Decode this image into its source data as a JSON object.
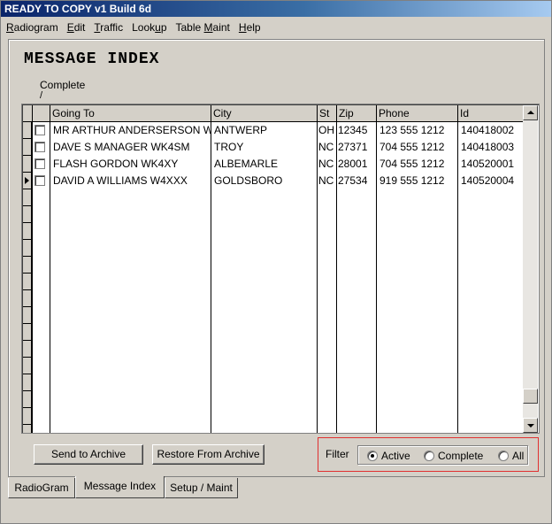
{
  "window": {
    "title": "READY TO COPY v1 Build 6d"
  },
  "menubar": {
    "items": [
      {
        "label_pre": "",
        "label_u": "R",
        "label_post": "adiogram"
      },
      {
        "label_pre": "",
        "label_u": "E",
        "label_post": "dit"
      },
      {
        "label_pre": "",
        "label_u": "T",
        "label_post": "raffic"
      },
      {
        "label_pre": "Look",
        "label_u": "u",
        "label_post": "p"
      },
      {
        "label_pre": "Table ",
        "label_u": "M",
        "label_post": "aint"
      },
      {
        "label_pre": "",
        "label_u": "H",
        "label_post": "elp"
      }
    ]
  },
  "page": {
    "title": "MESSAGE INDEX",
    "complete_column_label": "Complete",
    "complete_column_slash": "/"
  },
  "grid": {
    "headers": [
      "Going To",
      "City",
      "St",
      "Zip",
      "Phone",
      "Id"
    ],
    "rows": [
      {
        "complete": false,
        "going_to": "MR ARTHUR ANDERSERSON W",
        "city": "ANTWERP",
        "st": "OH",
        "zip": "12345",
        "phone": "123 555 1212",
        "id": "140418002",
        "current": false
      },
      {
        "complete": false,
        "going_to": "DAVE S MANAGER WK4SM",
        "city": "TROY",
        "st": "NC",
        "zip": "27371",
        "phone": "704 555 1212",
        "id": "140418003",
        "current": false
      },
      {
        "complete": false,
        "going_to": "FLASH GORDON WK4XY",
        "city": "ALBEMARLE",
        "st": "NC",
        "zip": "28001",
        "phone": "704 555 1212",
        "id": "140520001",
        "current": false
      },
      {
        "complete": false,
        "going_to": "DAVID A WILLIAMS W4XXX",
        "city": "GOLDSBORO",
        "st": "NC",
        "zip": "27534",
        "phone": "919 555 1212",
        "id": "140520004",
        "current": true
      }
    ]
  },
  "buttons": {
    "send_to_archive": "Send to Archive",
    "restore_from_archive": "Restore From Archive"
  },
  "filter": {
    "label": "Filter",
    "options": [
      {
        "label": "Active",
        "checked": true
      },
      {
        "label": "Complete",
        "checked": false
      },
      {
        "label": "All",
        "checked": false
      }
    ]
  },
  "tabs": [
    {
      "label": "RadioGram",
      "active": false
    },
    {
      "label": "Message Index",
      "active": true
    },
    {
      "label": "Setup / Maint",
      "active": false
    }
  ],
  "colors": {
    "title_bar_start": "#0a246a",
    "title_bar_end": "#a6caf0",
    "face": "#d4d0c8",
    "filter_highlight": "#e03030"
  }
}
